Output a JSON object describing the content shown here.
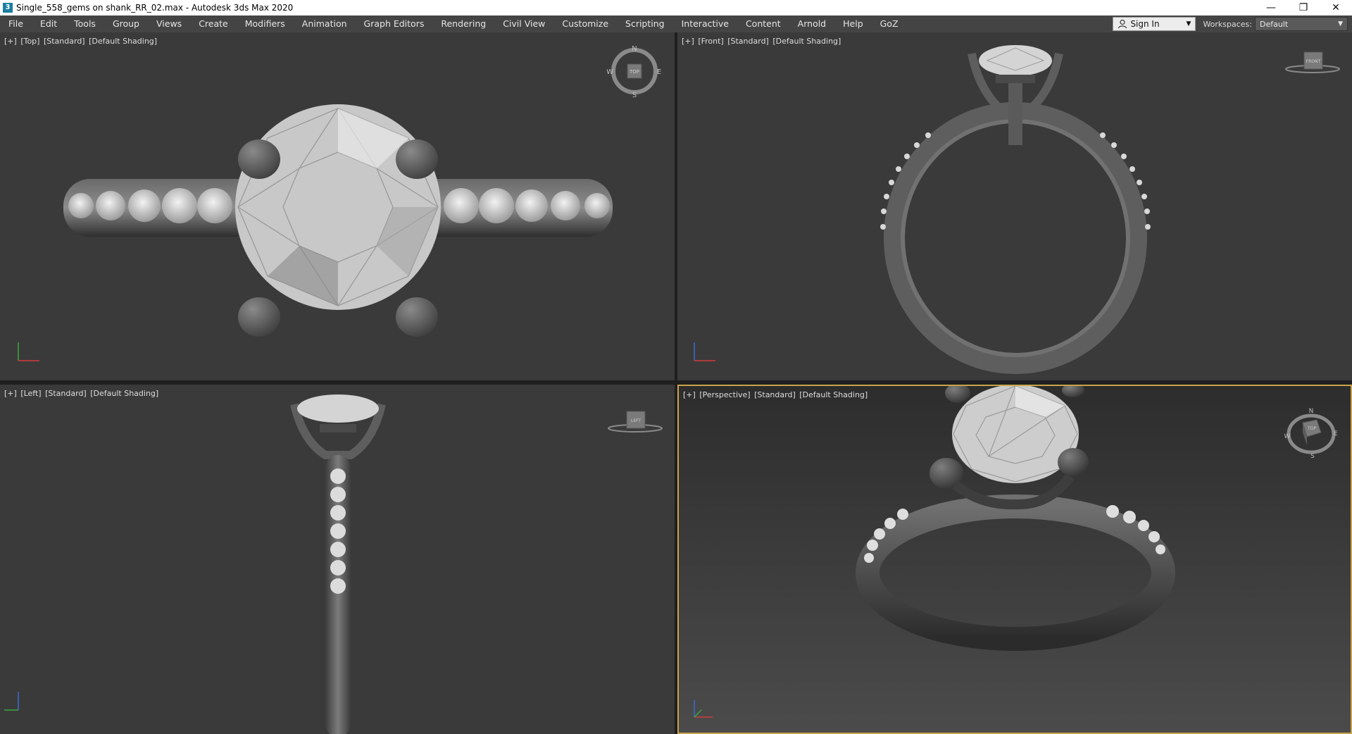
{
  "window": {
    "title": "Single_558_gems on shank_RR_02.max - Autodesk 3ds Max 2020",
    "app_icon_glyph": "3",
    "minimize_glyph": "—",
    "restore_glyph": "❐",
    "close_glyph": "✕"
  },
  "menu": {
    "items": [
      "File",
      "Edit",
      "Tools",
      "Group",
      "Views",
      "Create",
      "Modifiers",
      "Animation",
      "Graph Editors",
      "Rendering",
      "Civil View",
      "Customize",
      "Scripting",
      "Interactive",
      "Content",
      "Arnold",
      "Help",
      "GoZ"
    ],
    "sign_in": "Sign In",
    "workspaces_label": "Workspaces:",
    "workspace_value": "Default"
  },
  "viewports": {
    "top": {
      "plus": "[+]",
      "view": "[Top]",
      "mode": "[Standard]",
      "shading": "[Default Shading]",
      "cube_label": "TOP",
      "compass": {
        "n": "N",
        "s": "S",
        "e": "E",
        "w": "W"
      }
    },
    "front": {
      "plus": "[+]",
      "view": "[Front]",
      "mode": "[Standard]",
      "shading": "[Default Shading]",
      "cube_label": "FRONT"
    },
    "left": {
      "plus": "[+]",
      "view": "[Left]",
      "mode": "[Standard]",
      "shading": "[Default Shading]",
      "cube_label": "LEFT"
    },
    "perspective": {
      "plus": "[+]",
      "view": "[Perspective]",
      "mode": "[Standard]",
      "shading": "[Default Shading]",
      "cube_label": "TOP",
      "compass": {
        "n": "N",
        "s": "S",
        "e": "E",
        "w": "W"
      },
      "active": true
    }
  },
  "colors": {
    "viewport_bg": "#3a3a3a",
    "active_border": "#c9a54a",
    "menu_bg": "#444444",
    "axis_x": "#d23a3a",
    "axis_y": "#3aa83a",
    "axis_z": "#3a6ad2"
  }
}
